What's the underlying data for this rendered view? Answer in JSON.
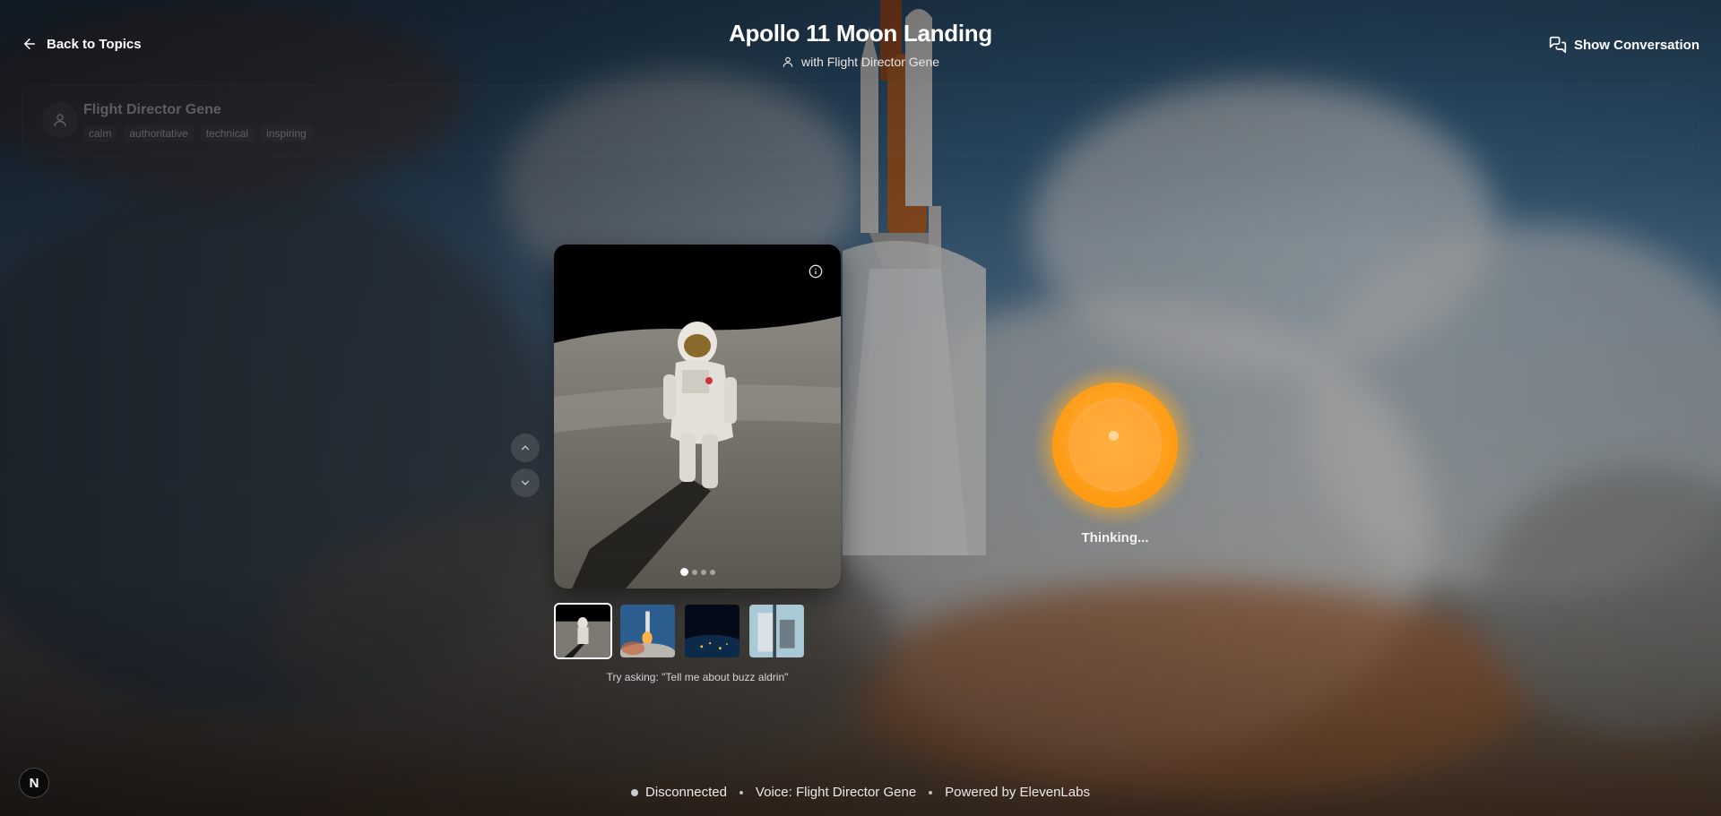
{
  "header": {
    "back_label": "Back to Topics",
    "title": "Apollo 11 Moon Landing",
    "subtitle": "with Flight Director Gene",
    "show_conversation_label": "Show Conversation"
  },
  "persona": {
    "name": "Flight Director Gene",
    "tags": [
      "calm",
      "authoritative",
      "technical",
      "inspiring"
    ]
  },
  "viewer": {
    "slide_count": 4,
    "active_slide": 0,
    "thumbnails": [
      "astronaut-on-moon",
      "rocket-launch",
      "earth-at-night",
      "lunar-module"
    ],
    "prompt": "Try asking: \"Tell me about buzz aldrin\""
  },
  "orb": {
    "status": "Thinking..."
  },
  "footer": {
    "connection_status": "Disconnected",
    "voice": "Voice: Flight Director Gene",
    "powered_by": "Powered by ElevenLabs",
    "logo_letter": "N"
  },
  "colors": {
    "orb": "#ffa323",
    "status_dot": "#c9ccd1"
  },
  "icons": {
    "back": "arrow-left-icon",
    "subtitle": "user-icon",
    "show_conversation": "chat-bubbles-icon",
    "info": "info-icon",
    "prev": "chevron-up-icon",
    "next": "chevron-down-icon"
  }
}
